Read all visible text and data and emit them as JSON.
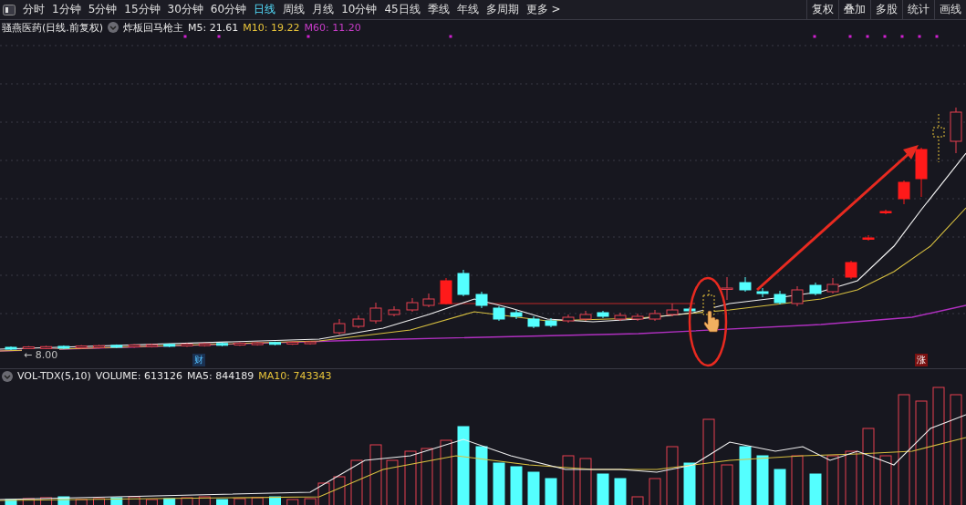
{
  "toolbar": {
    "tabs": [
      {
        "label": "分时",
        "selected": false
      },
      {
        "label": "1分钟",
        "selected": false
      },
      {
        "label": "5分钟",
        "selected": false
      },
      {
        "label": "15分钟",
        "selected": false
      },
      {
        "label": "30分钟",
        "selected": false
      },
      {
        "label": "60分钟",
        "selected": false
      },
      {
        "label": "日线",
        "selected": true
      },
      {
        "label": "周线",
        "selected": false
      },
      {
        "label": "月线",
        "selected": false
      },
      {
        "label": "10分钟",
        "selected": false
      },
      {
        "label": "45日线",
        "selected": false
      },
      {
        "label": "季线",
        "selected": false
      },
      {
        "label": "年线",
        "selected": false
      },
      {
        "label": "多周期",
        "selected": false
      }
    ],
    "more": "更多 >",
    "actions": [
      "复权",
      "叠加",
      "多股",
      "统计",
      "画线"
    ]
  },
  "price_panel": {
    "stock": "骚燕医药(日线.前复权)",
    "indicator": "炸板回马枪主",
    "averages": [
      {
        "text": "M5: 21.61",
        "color": "#e8e8e8"
      },
      {
        "text": "M10: 19.22",
        "color": "#e8c43a"
      },
      {
        "text": "M60: 11.20",
        "color": "#c83cc8"
      }
    ],
    "low_label": "← 8.00",
    "markers": [
      {
        "text": "财",
        "kind": "finance"
      },
      {
        "text": "涨",
        "kind": "rise"
      }
    ]
  },
  "volume_panel": {
    "indicator": "VOL-TDX(5,10)",
    "values": [
      {
        "text": "VOLUME: 613126",
        "color": "#e8e8e8"
      },
      {
        "text": "MA5: 844189",
        "color": "#e8e8e8"
      },
      {
        "text": "MA10: 743343",
        "color": "#e8c43a"
      }
    ]
  }
}
